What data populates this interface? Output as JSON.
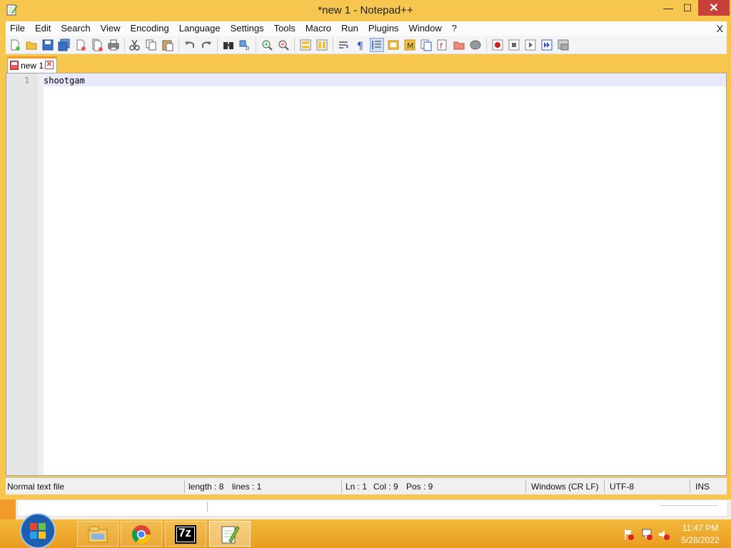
{
  "window": {
    "title": "*new 1 - Notepad++",
    "min_symbol": "—",
    "max_symbol": "☐",
    "close_symbol": "✕"
  },
  "menubar": {
    "items": [
      "File",
      "Edit",
      "Search",
      "View",
      "Encoding",
      "Language",
      "Settings",
      "Tools",
      "Macro",
      "Run",
      "Plugins",
      "Window",
      "?"
    ],
    "close_label": "X"
  },
  "toolbar": {
    "icons": [
      "new-file-icon",
      "open-file-icon",
      "save-icon",
      "save-all-icon",
      "close-icon",
      "close-all-icon",
      "print-icon",
      "cut-icon",
      "copy-icon",
      "paste-icon",
      "undo-icon",
      "redo-icon",
      "find-icon",
      "replace-icon",
      "zoom-in-icon",
      "zoom-out-icon",
      "sync-vertical-icon",
      "sync-horizontal-icon",
      "word-wrap-icon",
      "show-all-characters-icon",
      "indent-guide-icon",
      "user-defined-language-icon",
      "document-map-icon",
      "function-list-icon",
      "folder-as-workspace-icon",
      "monitoring-icon",
      "record-macro-icon",
      "stop-recording-icon",
      "playback-macro-icon",
      "run-macro-multiple-icon",
      "save-macro-icon"
    ]
  },
  "tabs": [
    {
      "label": "new 1",
      "modified": true,
      "close_symbol": "✕"
    }
  ],
  "editor": {
    "lines": [
      {
        "number": "1",
        "text": "shootgam"
      }
    ]
  },
  "statusbar": {
    "file_type": "Normal text file",
    "length": "length : 8",
    "lines": "lines : 1",
    "ln": "Ln : 1",
    "col": "Col : 9",
    "pos": "Pos : 9",
    "eol": "Windows (CR LF)",
    "encoding": "UTF-8",
    "mode": "INS"
  },
  "taskbar": {
    "apps": [
      "file-explorer",
      "chrome",
      "7-zip",
      "notepad++"
    ],
    "active_app": "notepad++",
    "seven_zip_label": "7z",
    "time": "11:47 PM",
    "date": "5/28/2022"
  },
  "colors": {
    "accent": "#f6c64f",
    "tab_highlight": "#f29a2a",
    "current_line": "#e8e8ff",
    "close_button": "#c7413a"
  }
}
